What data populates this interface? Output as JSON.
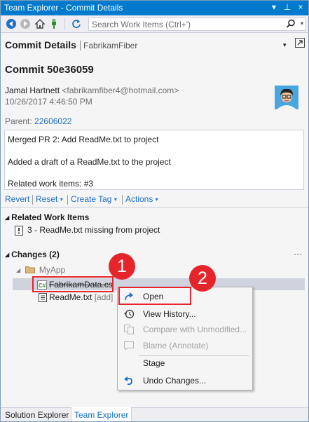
{
  "window": {
    "title": "Team Explorer - Commit Details",
    "dropdown_glyph": "▾",
    "pin_glyph": "⊥",
    "close_glyph": "×"
  },
  "toolbar": {
    "search_placeholder": "Search Work Items (Ctrl+')",
    "search_dropdown_glyph": "▾"
  },
  "header": {
    "title": "Commit Details",
    "project": "FabrikamFiber",
    "dropdown_glyph": "▾"
  },
  "commit": {
    "title": "Commit 50e36059",
    "author_name": "Jamal Hartnett",
    "author_email": "<fabrikamfiber4@hotmail.com>",
    "date": "10/26/2017 4:46:50 PM",
    "parent_label": "Parent:",
    "parent_id": "22606022",
    "message_lines": [
      "Merged PR 2: Add ReadMe.txt to project",
      "Added a draft of a ReadMe.txt to the project",
      "Related work items: #3"
    ]
  },
  "actions": {
    "revert": "Revert",
    "reset": "Reset",
    "create_tag": "Create Tag",
    "actions": "Actions",
    "caret": "▾"
  },
  "related_work_items": {
    "header": "Related Work Items",
    "toggle_glyph": "◢",
    "items": [
      {
        "label": "3 - ReadMe.txt missing from project"
      }
    ]
  },
  "changes": {
    "header": "Changes (2)",
    "toggle_glyph": "◢",
    "more_glyph": "···",
    "folder_toggle_glyph": "◢",
    "folder": "MyApp",
    "files": [
      {
        "name": "FabrikamData.cs",
        "status": ""
      },
      {
        "name": "ReadMe.txt",
        "status": "[add]"
      }
    ]
  },
  "callouts": {
    "step1": "1",
    "step2": "2"
  },
  "context_menu": {
    "items": [
      {
        "label": "Open",
        "enabled": true
      },
      {
        "label": "View History...",
        "enabled": true
      },
      {
        "label": "Compare with Unmodified...",
        "enabled": false
      },
      {
        "label": "Blame (Annotate)",
        "enabled": false
      },
      {
        "label": "Stage",
        "enabled": true
      },
      {
        "label": "Undo Changes...",
        "enabled": true
      }
    ]
  },
  "bottom_tabs": {
    "solution_explorer": "Solution Explorer",
    "team_explorer": "Team Explorer"
  },
  "colors": {
    "accent": "#007acc",
    "link": "#1e6fc5",
    "callout": "#e4262c",
    "selection": "#cfd3de"
  },
  "icons": {
    "back": "back-arrow-icon",
    "forward": "forward-arrow-icon",
    "home": "home-icon",
    "connect": "plug-icon",
    "refresh": "refresh-icon",
    "search": "search-icon",
    "popout": "popout-icon"
  }
}
